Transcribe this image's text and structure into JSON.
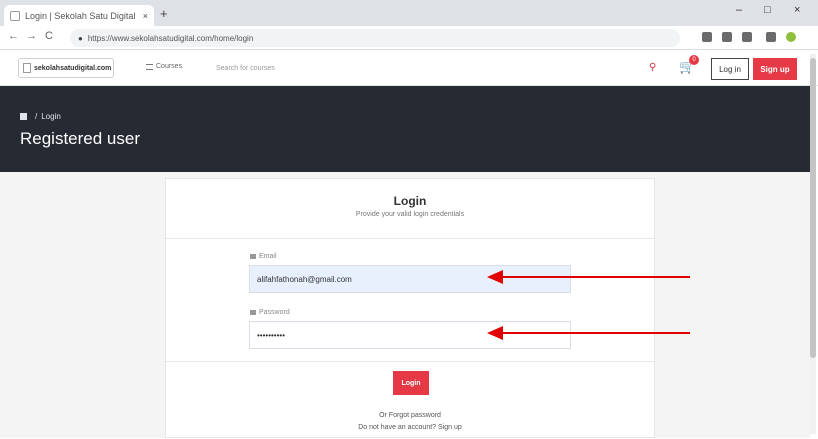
{
  "browser": {
    "tab_title": "Login | Sekolah Satu Digital",
    "tab_close": "×",
    "new_tab": "+",
    "window_controls": [
      "–",
      "□",
      "×"
    ],
    "nav": {
      "back": "←",
      "forward": "→",
      "reload": "C"
    },
    "address": "https://www.sekolahsatudigital.com/home/login",
    "lock_icon": "lock-icon"
  },
  "site_header": {
    "logo_text": "sekolahsatudigital.com",
    "categories_label": "Courses",
    "search_placeholder": "Search for courses",
    "cart_count": "0",
    "login_label": "Log in",
    "signup_label": "Sign up",
    "accent_color": "#e53945"
  },
  "hero": {
    "breadcrumb": {
      "current": "Login",
      "separator": "/"
    },
    "title": "Registered user",
    "background": "#262a33"
  },
  "login_card": {
    "title": "Login",
    "subtitle": "Provide your valid login credentials",
    "email": {
      "label": "Email",
      "value": "alifahfathonah@gmail.com"
    },
    "password": {
      "label": "Password",
      "value": "••••••••••"
    },
    "submit_label": "Login",
    "forgot": {
      "prefix": "Or",
      "link": "Forgot password"
    },
    "signup_prompt": {
      "text": "Do not have an account?",
      "link": "Sign up"
    }
  },
  "annotations": {
    "arrow_color": "#e00000",
    "arrow_count": 2
  }
}
